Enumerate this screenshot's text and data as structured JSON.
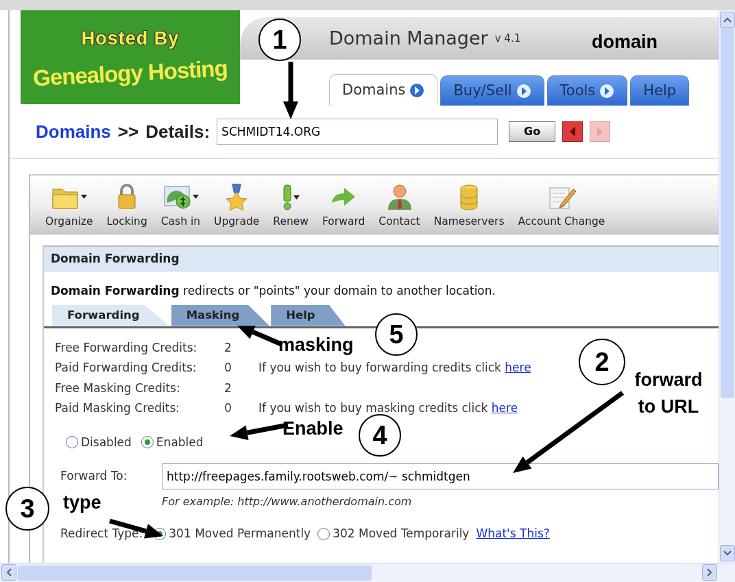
{
  "header": {
    "logo_top": "Hosted By",
    "logo_bottom": "Genealogy Hosting",
    "title": "Domain Manager",
    "version": "v 4.1",
    "tabs": [
      {
        "label": "Domains",
        "selected": true,
        "has_arrow": true
      },
      {
        "label": "Buy/Sell",
        "selected": false,
        "has_arrow": true
      },
      {
        "label": "Tools",
        "selected": false,
        "has_arrow": true
      },
      {
        "label": "Help",
        "selected": false,
        "has_arrow": false
      }
    ]
  },
  "breadcrumb": {
    "link": "Domains",
    "separator": ">>",
    "label": "Details:",
    "domain": "SCHMIDT14.ORG",
    "go": "Go",
    "prev_disabled": false,
    "next_disabled": true
  },
  "toolbar": [
    {
      "kind": "folder",
      "label": "Organize",
      "dropdown": true
    },
    {
      "kind": "lock",
      "label": "Locking",
      "dropdown": false
    },
    {
      "kind": "cash",
      "label": "Cash in",
      "dropdown": true
    },
    {
      "kind": "medal",
      "label": "Upgrade",
      "dropdown": false
    },
    {
      "kind": "exclamation",
      "label": "Renew",
      "dropdown": true
    },
    {
      "kind": "arrow",
      "label": "Forward",
      "dropdown": false
    },
    {
      "kind": "person",
      "label": "Contact",
      "dropdown": false
    },
    {
      "kind": "database",
      "label": "Nameservers",
      "dropdown": false
    },
    {
      "kind": "notepad",
      "label": "Account Change",
      "dropdown": false
    }
  ],
  "forwarding": {
    "title": "Domain Forwarding",
    "description": "**Domain Forwarding** redirects or \"points\" your domain to another location.",
    "tabs": [
      {
        "label": "Forwarding",
        "selected": true
      },
      {
        "label": "Masking",
        "selected": false
      },
      {
        "label": "Help",
        "selected": false
      }
    ],
    "credits": [
      {
        "label": "Free Forwarding Credits:",
        "value": "2"
      },
      {
        "label": "Paid Forwarding Credits:",
        "value": "0",
        "note": "If you wish to buy forwarding credits click",
        "link": "here"
      },
      {
        "label": "Free Masking Credits:",
        "value": "2"
      },
      {
        "label": "Paid Masking Credits:",
        "value": "0",
        "note": "If you wish to buy masking credits click",
        "link": "here"
      }
    ],
    "status_options": [
      {
        "label": "Disabled",
        "selected": false
      },
      {
        "label": "Enabled",
        "selected": true
      }
    ],
    "forward_to": {
      "label": "Forward To:",
      "value": "http://freepages.family.rootsweb.com/~ schmidtgen",
      "example": "For example: http://www.anotherdomain.com"
    },
    "redirect": {
      "label": "Redirect Type:",
      "options": [
        {
          "label": "301 Moved Permanently",
          "selected": true
        },
        {
          "label": "302 Moved Temporarily",
          "selected": false
        }
      ],
      "help_link": "What's This?"
    }
  },
  "annotations": [
    {
      "number": "1",
      "label": "domain"
    },
    {
      "number": "5",
      "label": "masking"
    },
    {
      "number": "4",
      "label": "Enable"
    },
    {
      "number": "2",
      "label": "forward to URL"
    },
    {
      "number": "3",
      "label": "type"
    }
  ]
}
